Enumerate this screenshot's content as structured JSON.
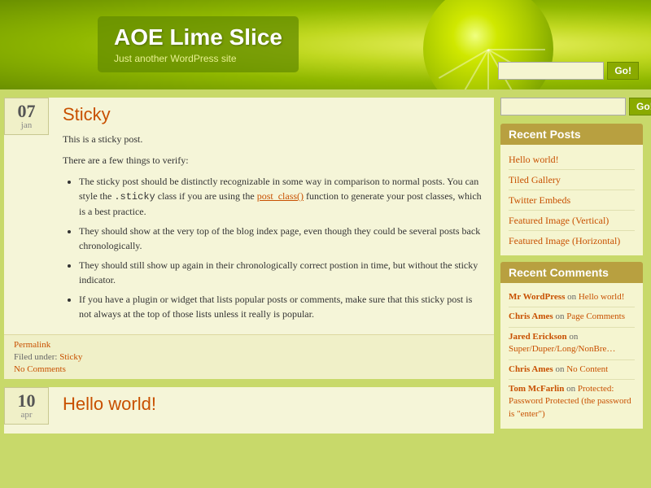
{
  "header": {
    "title": "AOE Lime Slice",
    "tagline": "Just another WordPress site",
    "search_placeholder": "",
    "search_button": "Go!",
    "search_placeholder2": "",
    "search_button2": "Go!"
  },
  "posts": [
    {
      "day": "07",
      "month": "jan",
      "title": "Sticky",
      "intro1": "This is a sticky post.",
      "intro2": "There are a few things to verify:",
      "bullets": [
        "The sticky post should be distinctly recognizable in some way in comparison to normal posts. You can style the .sticky class if you are using the post_class() function to generate your post classes, which is a best practice.",
        "They should show at the very top of the blog index page, even though they could be several posts back chronologically.",
        "They should still show up again in their chronologically correct postion in time, but without the sticky indicator.",
        "If you have a plugin or widget that lists popular posts or comments, make sure that this sticky post is not always at the top of those lists unless it really is popular."
      ],
      "permalink_label": "Permalink",
      "filed_label": "Filed under:",
      "filed_link": "Sticky",
      "comments_link": "No Comments"
    },
    {
      "day": "10",
      "month": "apr",
      "title": "Hello world!",
      "intro1": "",
      "intro2": "",
      "bullets": []
    }
  ],
  "sidebar": {
    "search_placeholder": "",
    "search_button": "Go!",
    "recent_posts_title": "Recent Posts",
    "recent_posts": [
      {
        "label": "Hello world!"
      },
      {
        "label": "Tiled Gallery"
      },
      {
        "label": "Twitter Embeds"
      },
      {
        "label": "Featured Image (Vertical)"
      },
      {
        "label": "Featured Image (Horizontal)"
      }
    ],
    "recent_comments_title": "Recent Comments",
    "recent_comments": [
      {
        "author": "Mr WordPress",
        "on": "on",
        "link": "Hello world!"
      },
      {
        "author": "Chris Ames",
        "on": "on",
        "link": "Page Comments"
      },
      {
        "author": "Jared Erickson",
        "on": "on",
        "link": "Super/Duper/Long/NonBre…"
      },
      {
        "author": "Chris Ames",
        "on": "on",
        "link": "No Content"
      },
      {
        "author": "Tom McFarlin",
        "on": "on",
        "link": "Protected: Password Protected (the password is \"enter\")"
      }
    ]
  }
}
